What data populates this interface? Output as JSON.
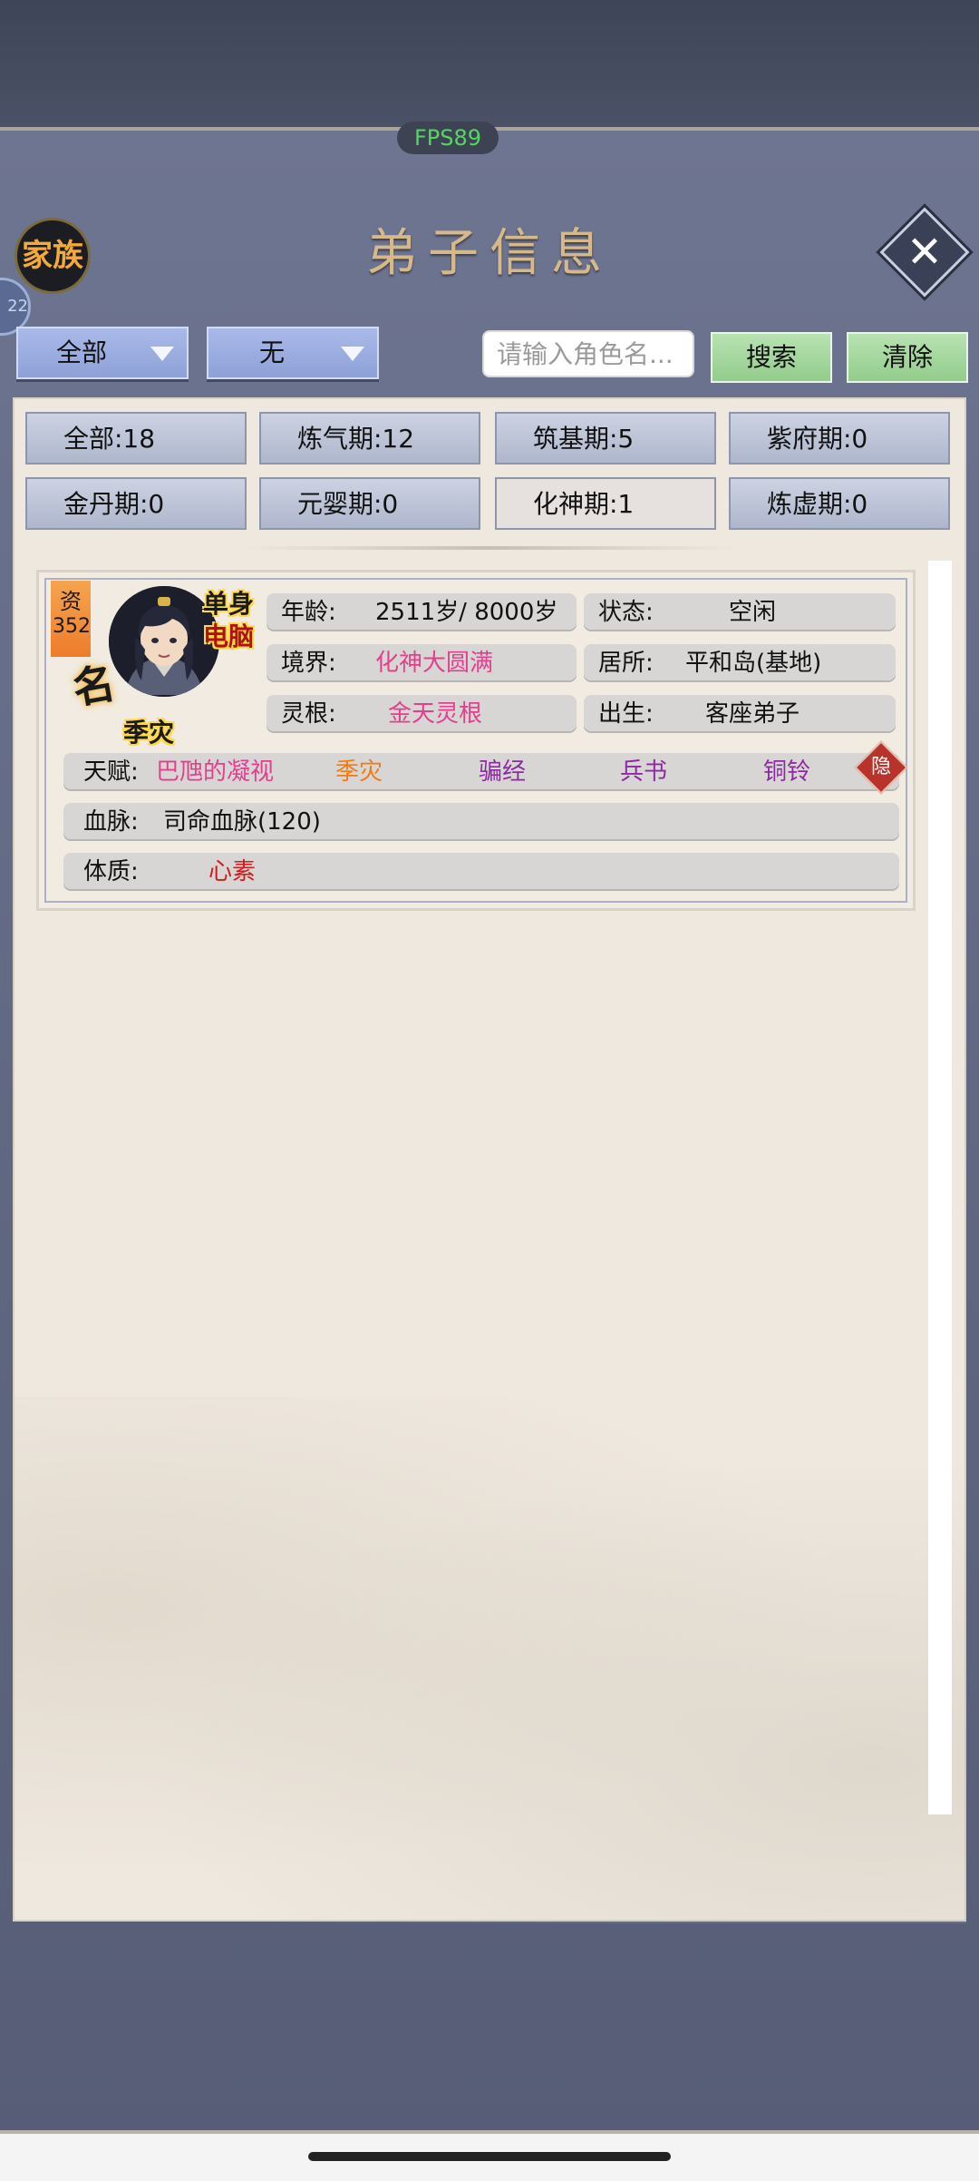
{
  "fps": "FPS89",
  "header": {
    "clan_label": "家族",
    "badge_text": "22",
    "title": "弟子信息",
    "close_icon": "close-icon"
  },
  "filters": {
    "dropdown1": "全部",
    "dropdown2": "无",
    "search_placeholder": "请输入角色名...",
    "search_label": "搜索",
    "clear_label": "清除"
  },
  "tabs": [
    "全部:18",
    "炼气期:12",
    "筑基期:5",
    "紫府期:0",
    "金丹期:0",
    "元婴期:0",
    "化神期:1",
    "炼虚期:0"
  ],
  "disciple": {
    "zi_label": "资",
    "zi_value": "352",
    "ming_label": "名",
    "single_label": "单身",
    "pc_label": "电脑",
    "name": "季灾",
    "age_label": "年龄:",
    "age_value": "2511岁/ 8000岁",
    "status_label": "状态:",
    "status_value": "空闲",
    "realm_label": "境界:",
    "realm_value": "化神大圆满",
    "home_label": "居所:",
    "home_value": "平和岛(基地)",
    "root_label": "灵根:",
    "root_value": "金天灵根",
    "birth_label": "出生:",
    "birth_value": "客座弟子",
    "talent_label": "天赋:",
    "talents": [
      "巴虺的凝视",
      "季灾",
      "骗经",
      "兵书",
      "铜铃"
    ],
    "hide_label": "隐",
    "blood_label": "血脉:",
    "blood_value": "司命血脉(120)",
    "body_label": "体质:",
    "body_value": "心素"
  },
  "colors": {
    "pink": "#e43f8e",
    "purple": "#8d2aa3",
    "orange": "#f07b14",
    "red": "#d21c1c"
  }
}
